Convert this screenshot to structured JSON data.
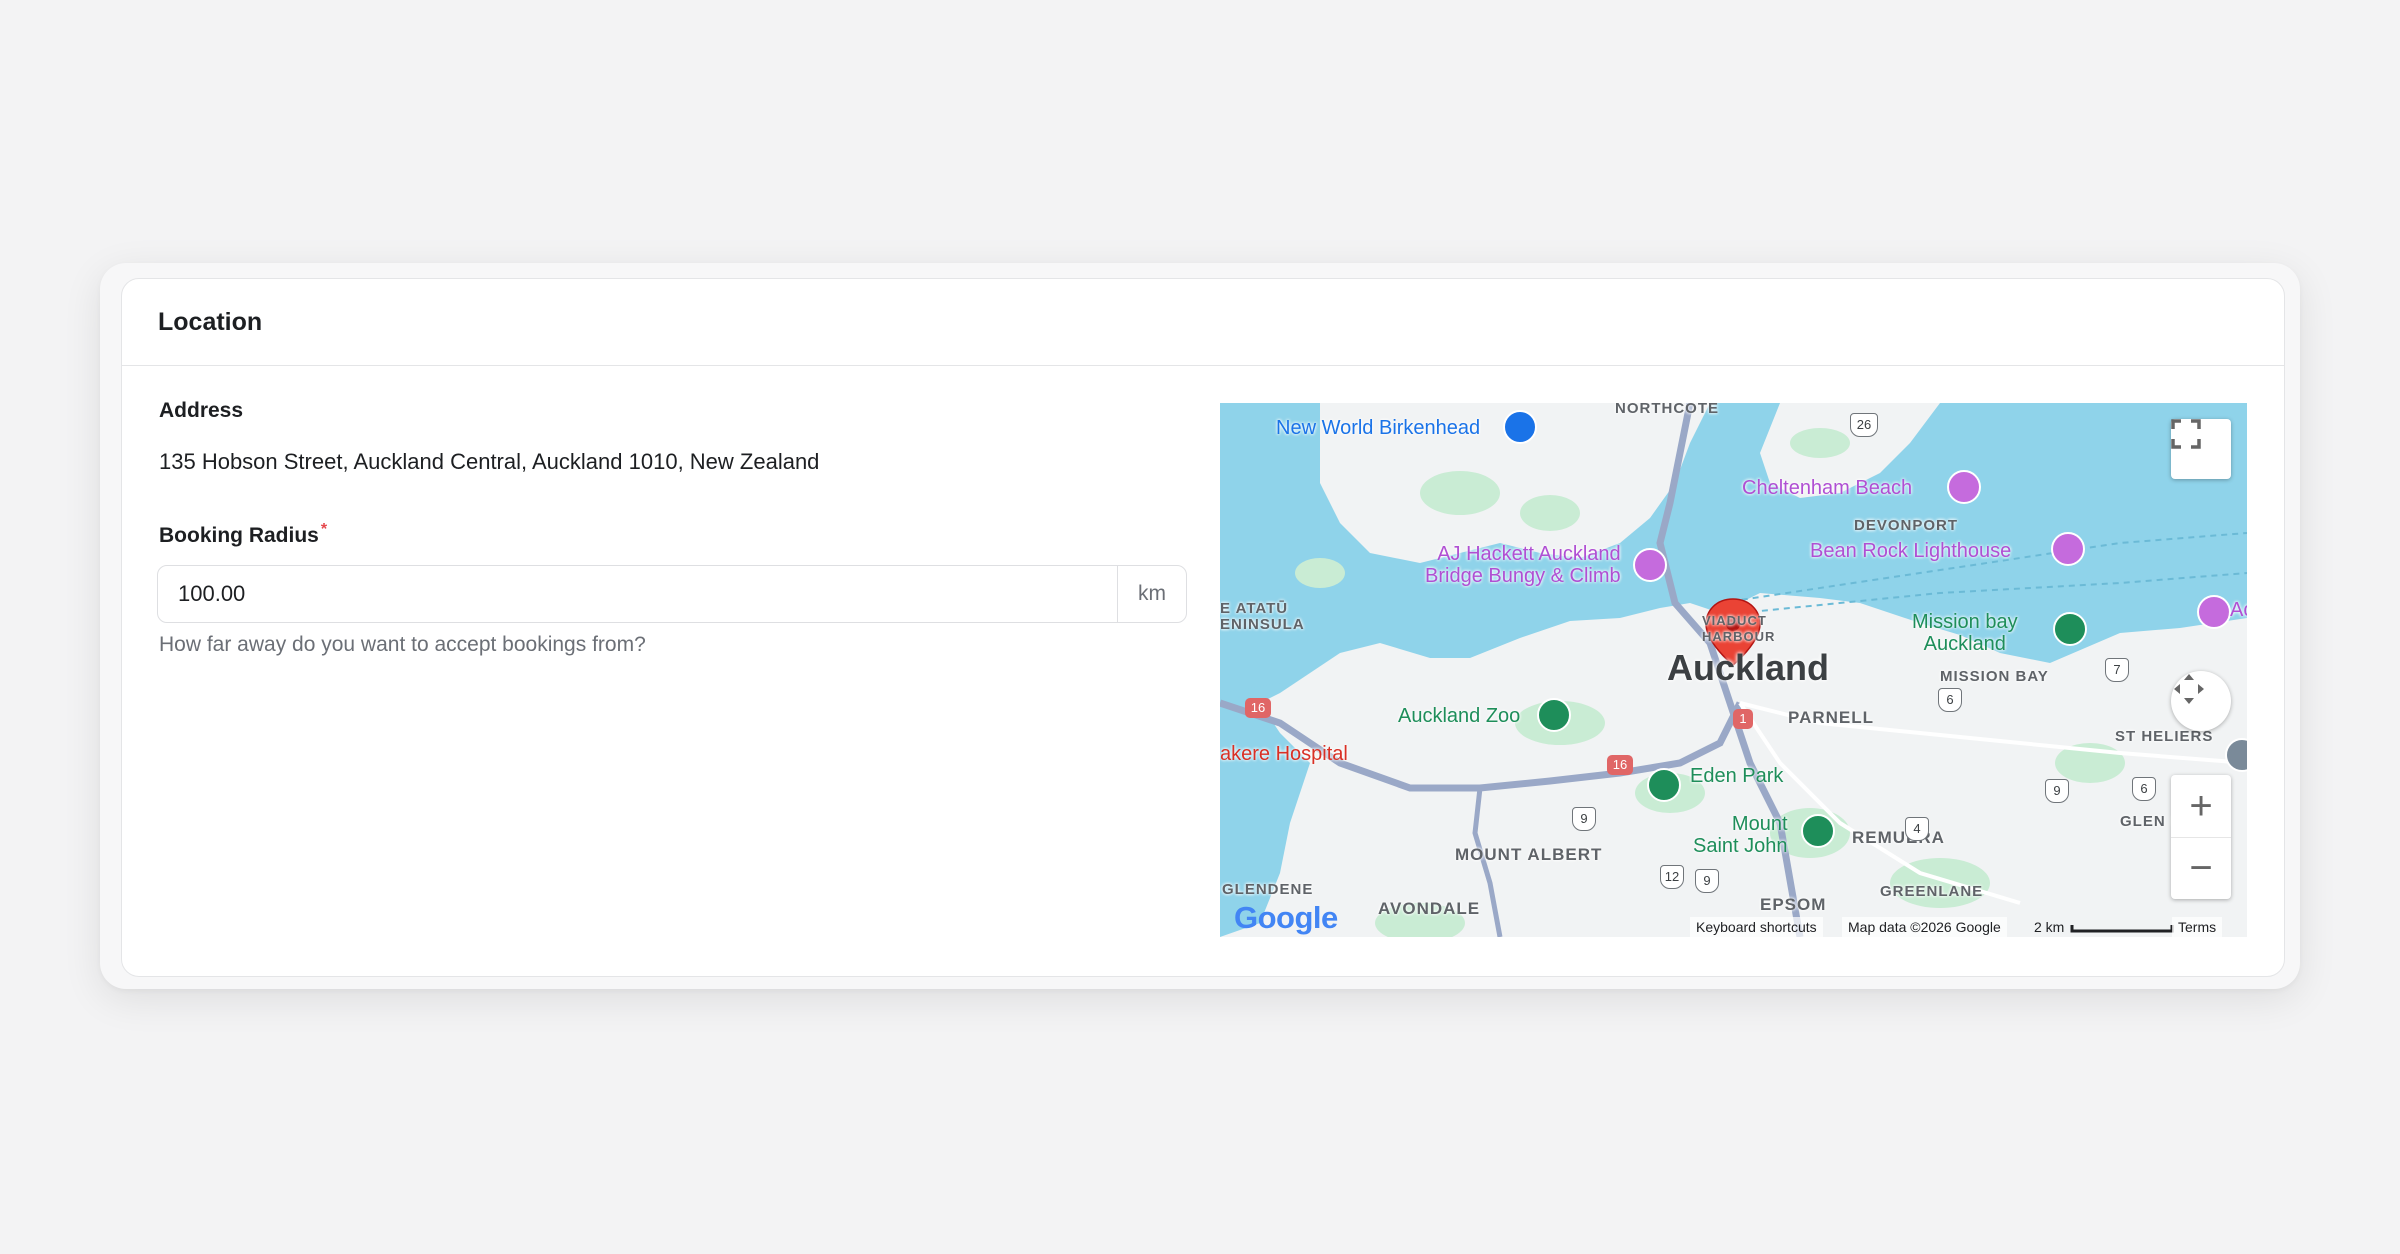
{
  "section": {
    "title": "Location"
  },
  "address": {
    "label": "Address",
    "value": "135 Hobson Street, Auckland Central, Auckland 1010, New Zealand"
  },
  "booking_radius": {
    "label": "Booking Radius",
    "required_mark": "*",
    "value": "100.00",
    "unit": "km",
    "hint": "How far away do you want to accept bookings from?"
  },
  "map": {
    "city_label": "Auckland",
    "places": {
      "new_world": "New World Birkenhead",
      "cheltenham": "Cheltenham Beach",
      "aj_hackett_1": "AJ Hackett Auckland",
      "aj_hackett_2": "Bridge Bungy & Climb",
      "bean_rock": "Bean Rock Lighthouse",
      "mission_bay_1": "Mission bay",
      "mission_bay_2": "Auckland",
      "auckland_zoo": "Auckland Zoo",
      "eden_park": "Eden Park",
      "mount_saint_john_1": "Mount",
      "mount_saint_john_2": "Saint John",
      "hospital": "akere Hospital",
      "right_edge": "Acl"
    },
    "suburbs": {
      "northcote": "NORTHCOTE",
      "devonport": "DEVONPORT",
      "te_atatu_1": "E ATATŪ",
      "te_atatu_2": "ENINSULA",
      "viaduct_1": "VIADUCT",
      "viaduct_2": "HARBOUR",
      "mission_bay": "MISSION BAY",
      "parnell": "PARNELL",
      "st_heliers": "ST HELIERS",
      "mount_albert": "MOUNT ALBERT",
      "remuera": "REMUERA",
      "glen_innes": "GLEN IN",
      "glendene": "GLENDENE",
      "avondale": "AVONDALE",
      "epsom": "EPSOM",
      "greenlane": "GREENLANE"
    },
    "road_shields": {
      "s26": "26",
      "s16a": "16",
      "s16b": "16",
      "s1": "1",
      "s7": "7",
      "s6a": "6",
      "s6b": "6",
      "s9a": "9",
      "s9b": "9",
      "s9c": "9",
      "s4": "4",
      "s12": "12"
    },
    "attribution": {
      "logo": "Google",
      "keyboard_shortcuts": "Keyboard shortcuts",
      "map_data": "Map data ©2026 Google",
      "scale": "2 km",
      "terms": "Terms"
    },
    "controls": {
      "fullscreen_icon": "fullscreen-icon",
      "pan_icon": "pan-arrows-icon",
      "zoom_in": "+",
      "zoom_out": "−"
    },
    "colors": {
      "water": "#8fd3ea",
      "land": "#f1f3f4",
      "park": "#c9ecd4",
      "pin": "#ea4335"
    }
  }
}
